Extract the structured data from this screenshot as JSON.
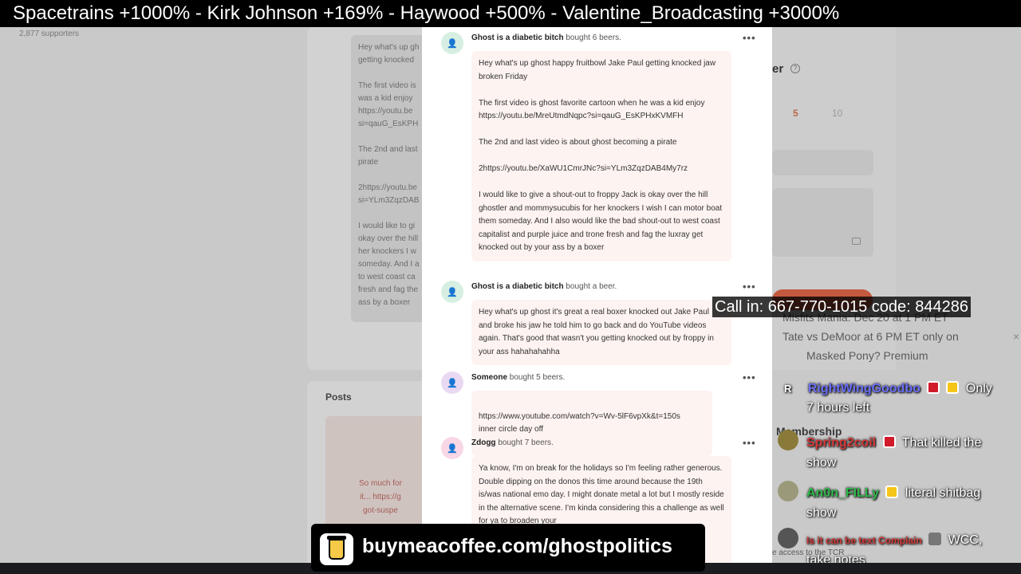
{
  "ticker": "Spacetrains +1000%   -  Kirk Johnson +169%  -  Haywood +500%  -  Valentine_Broadcasting +3000%",
  "background": {
    "supporters": "2,877 supporters",
    "left_column_text": "Hey what's up gh\ngetting knocked\n\nThe first video is\nwas a kid enjoy\nhttps://youtu.be\nsi=qauG_EsKPH\n\nThe 2nd and last\npirate\n\n2https://youtu.be\nsi=YLm3ZqzDAB\n\nI would like to gi\nokay over the hill\nher knockers I w\nsomeday. And I a\nto west coast ca\nfresh and fag the\nass by a boxer",
    "posts_title": "Posts",
    "posts_text": "So much for\nit... https://g\ngot-suspe",
    "right_heading": "er",
    "right_help": "?",
    "amount_selected": "5",
    "amount_other": "10"
  },
  "entries": [
    {
      "avatar": "👤",
      "name": "Ghost is a diabetic bitch",
      "action": "bought 6 beers.",
      "message": [
        "Hey what's up ghost happy fruitbowl Jake Paul getting knocked jaw broken Friday",
        "The first video is ghost favorite cartoon when he was a kid enjoy\nhttps://youtu.be/MreUtmdNqpc?si=qauG_EsKPHxKVMFH",
        "The 2nd and last video is about ghost becoming a pirate",
        "2https://youtu.be/XaWU1CmrJNc?si=YLm3ZqzDAB4My7rz",
        "I would like to give a shout-out to froppy Jack is okay over the hill ghostler and mommysucubis for her knockers I wish I can motor boat them someday. And I also would like the bad shout-out to west coast capitalist and purple juice and trone fresh and fag the luxray get knocked out by your ass by a boxer"
      ]
    },
    {
      "avatar": "👤",
      "name": "Ghost is a diabetic bitch",
      "action": "bought a beer.",
      "message": [
        "Hey what's up ghost it's great a real boxer knocked out Jake Paul and broke his jaw he told him to go back and do YouTube videos again. That's good that wasn't you getting knocked out by froppy in your ass hahahahahha"
      ]
    },
    {
      "avatar": "👤",
      "name": "Someone",
      "action": "bought 5 beers.",
      "message": [
        "https://www.youtube.com/watch?v=Wv-5lF6vpXk&t=150s\ninner circle day off"
      ]
    },
    {
      "avatar": "👤",
      "name": "Zdogg",
      "action": "bought 7 beers.",
      "message": [
        "Ya know, I'm on break for the holidays so I'm feeling rather generous. Double dipping on the donos this time around because the 19th is/was national emo day. I might donate metal a lot but I mostly reside in the alternative scene. I'm kinda considering this a challenge as well for ya to broaden your"
      ]
    }
  ],
  "callin": "Call in: 667-770-1015 code: 844286",
  "chat": {
    "bg_lines": [
      "Misfits Mania: Dec 20 at 1 PM ET",
      "Tate vs DeMoor at 6 PM ET only on",
      "Masked Pony? Premium",
      "Membership",
      "e access to the TCR"
    ],
    "messages": [
      {
        "initial": "R",
        "user": "RightWingGoodbo",
        "text": "Only",
        "text2": "7 hours left"
      },
      {
        "user": "Spring2coil",
        "text": "That killed the",
        "text2": "show"
      },
      {
        "user": "An0n_FILLy",
        "text": "literal shitbag",
        "text2": "show"
      },
      {
        "user": "Is it can be text Complain",
        "text": "WCC,",
        "text2": "take notes"
      }
    ],
    "close": "×"
  },
  "banner": {
    "text": "buymeacoffee.com/ghostpolitics",
    "cup_color": "#f7c948"
  }
}
